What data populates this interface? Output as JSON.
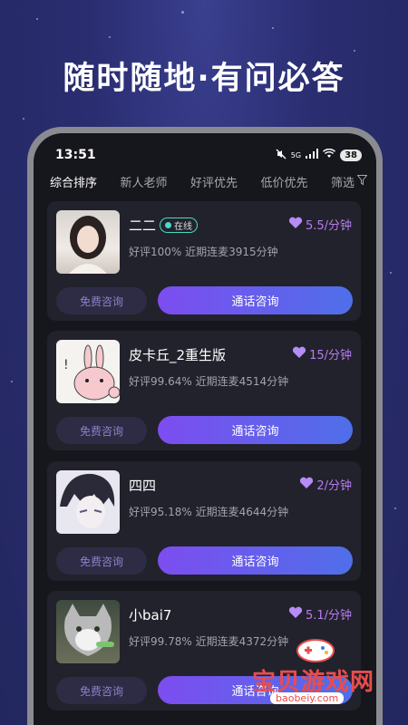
{
  "headline": "随时随地·有问必答",
  "status": {
    "time": "13:51",
    "network": "5G",
    "battery": "38"
  },
  "tabs": [
    {
      "label": "综合排序",
      "active": true
    },
    {
      "label": "新人老师",
      "active": false
    },
    {
      "label": "好评优先",
      "active": false
    },
    {
      "label": "低价优先",
      "active": false
    }
  ],
  "filter_label": "筛选",
  "cards": [
    {
      "name": "二二",
      "online_label": "在线",
      "price": "5.5/分钟",
      "stats": "好评100%  近期连麦3915分钟",
      "free_label": "免费咨询",
      "call_label": "通话咨询"
    },
    {
      "name": "皮卡丘_2重生版",
      "price": "15/分钟",
      "stats": "好评99.64%  近期连麦4514分钟",
      "free_label": "免费咨询",
      "call_label": "通话咨询"
    },
    {
      "name": "四四",
      "price": "2/分钟",
      "stats": "好评95.18%  近期连麦4644分钟",
      "free_label": "免费咨询",
      "call_label": "通话咨询"
    },
    {
      "name": "小bai7",
      "price": "5.1/分钟",
      "stats": "好评99.78%  近期连麦4372分钟",
      "free_label": "免费咨询",
      "call_label": "通话咨询"
    }
  ],
  "watermark": {
    "text": "宝贝游戏网",
    "url": "baobeiy.com"
  },
  "colors": {
    "accent": "#b77cf0",
    "button_gradient_start": "#7d4df0",
    "button_gradient_end": "#4f6fe9",
    "online": "#4ad9c6"
  }
}
